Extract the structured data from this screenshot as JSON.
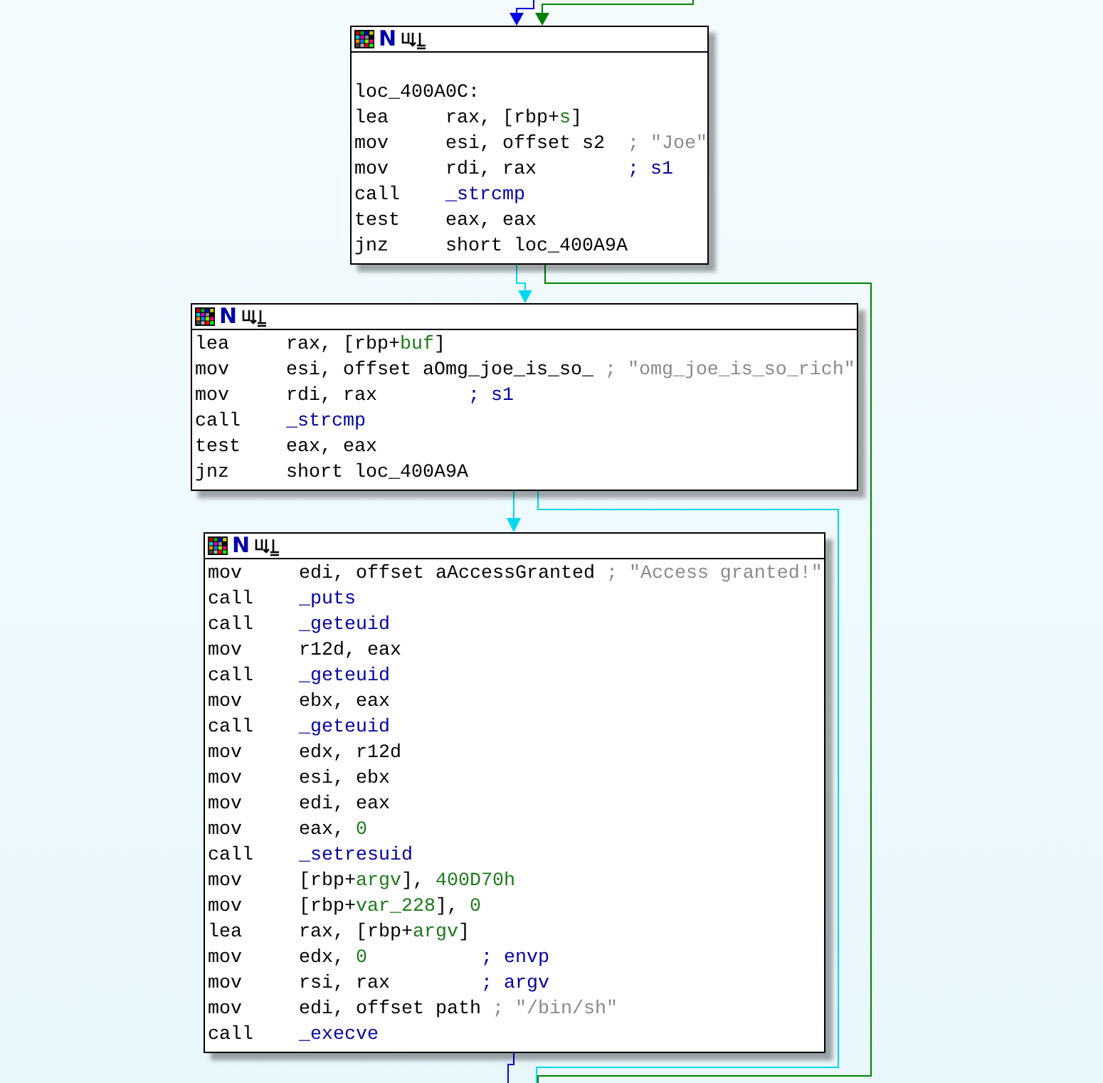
{
  "blocks": [
    {
      "header_glyph": "N",
      "label": "loc_400A0C:",
      "lines": [
        {
          "mnemonic": "lea",
          "operand": [
            {
              "text": "rax, [rbp+",
              "kind": "plain"
            },
            {
              "text": "s",
              "kind": "var"
            },
            {
              "text": "]",
              "kind": "plain"
            }
          ]
        },
        {
          "mnemonic": "mov",
          "operand": [
            {
              "text": "esi, offset s2",
              "kind": "plain"
            }
          ],
          "comment": [
            {
              "text": "; \"Joe\"",
              "kind": "string"
            }
          ]
        },
        {
          "mnemonic": "mov",
          "operand": [
            {
              "text": "rdi, rax",
              "kind": "plain"
            }
          ],
          "comment": [
            {
              "text": "; s1",
              "kind": "comment"
            }
          ]
        },
        {
          "mnemonic": "call",
          "operand": [
            {
              "text": "_strcmp",
              "kind": "func"
            }
          ]
        },
        {
          "mnemonic": "test",
          "operand": [
            {
              "text": "eax, eax",
              "kind": "plain"
            }
          ]
        },
        {
          "mnemonic": "jnz",
          "operand": [
            {
              "text": "short loc_400A9A",
              "kind": "plain"
            }
          ]
        }
      ]
    },
    {
      "header_glyph": "N",
      "lines": [
        {
          "mnemonic": "lea",
          "operand": [
            {
              "text": "rax, [rbp+",
              "kind": "plain"
            },
            {
              "text": "buf",
              "kind": "var"
            },
            {
              "text": "]",
              "kind": "plain"
            }
          ]
        },
        {
          "mnemonic": "mov",
          "operand": [
            {
              "text": "esi, offset aOmg_joe_is_so_",
              "kind": "plain"
            }
          ],
          "comment": [
            {
              "text": "; \"omg_joe_is_so_rich\"",
              "kind": "string"
            }
          ]
        },
        {
          "mnemonic": "mov",
          "operand": [
            {
              "text": "rdi, rax",
              "kind": "plain"
            }
          ],
          "comment": [
            {
              "text": "; s1",
              "kind": "comment"
            }
          ]
        },
        {
          "mnemonic": "call",
          "operand": [
            {
              "text": "_strcmp",
              "kind": "func"
            }
          ]
        },
        {
          "mnemonic": "test",
          "operand": [
            {
              "text": "eax, eax",
              "kind": "plain"
            }
          ]
        },
        {
          "mnemonic": "jnz",
          "operand": [
            {
              "text": "short loc_400A9A",
              "kind": "plain"
            }
          ]
        }
      ]
    },
    {
      "header_glyph": "N",
      "lines": [
        {
          "mnemonic": "mov",
          "operand": [
            {
              "text": "edi, offset aAccessGranted",
              "kind": "plain"
            }
          ],
          "comment": [
            {
              "text": "; \"Access granted!\"",
              "kind": "string"
            }
          ]
        },
        {
          "mnemonic": "call",
          "operand": [
            {
              "text": "_puts",
              "kind": "func"
            }
          ]
        },
        {
          "mnemonic": "call",
          "operand": [
            {
              "text": "_geteuid",
              "kind": "func"
            }
          ]
        },
        {
          "mnemonic": "mov",
          "operand": [
            {
              "text": "r12d, eax",
              "kind": "plain"
            }
          ]
        },
        {
          "mnemonic": "call",
          "operand": [
            {
              "text": "_geteuid",
              "kind": "func"
            }
          ]
        },
        {
          "mnemonic": "mov",
          "operand": [
            {
              "text": "ebx, eax",
              "kind": "plain"
            }
          ]
        },
        {
          "mnemonic": "call",
          "operand": [
            {
              "text": "_geteuid",
              "kind": "func"
            }
          ]
        },
        {
          "mnemonic": "mov",
          "operand": [
            {
              "text": "edx, r12d",
              "kind": "plain"
            }
          ]
        },
        {
          "mnemonic": "mov",
          "operand": [
            {
              "text": "esi, ebx",
              "kind": "plain"
            }
          ]
        },
        {
          "mnemonic": "mov",
          "operand": [
            {
              "text": "edi, eax",
              "kind": "plain"
            }
          ]
        },
        {
          "mnemonic": "mov",
          "operand": [
            {
              "text": "eax, ",
              "kind": "plain"
            },
            {
              "text": "0",
              "kind": "num"
            }
          ]
        },
        {
          "mnemonic": "call",
          "operand": [
            {
              "text": "_setresuid",
              "kind": "func"
            }
          ]
        },
        {
          "mnemonic": "mov",
          "operand": [
            {
              "text": "[rbp+",
              "kind": "plain"
            },
            {
              "text": "argv",
              "kind": "var"
            },
            {
              "text": "], ",
              "kind": "plain"
            },
            {
              "text": "400D70h",
              "kind": "num"
            }
          ]
        },
        {
          "mnemonic": "mov",
          "operand": [
            {
              "text": "[rbp+",
              "kind": "plain"
            },
            {
              "text": "var_228",
              "kind": "var"
            },
            {
              "text": "], ",
              "kind": "plain"
            },
            {
              "text": "0",
              "kind": "num"
            }
          ]
        },
        {
          "mnemonic": "lea",
          "operand": [
            {
              "text": "rax, [rbp+",
              "kind": "plain"
            },
            {
              "text": "argv",
              "kind": "var"
            },
            {
              "text": "]",
              "kind": "plain"
            }
          ]
        },
        {
          "mnemonic": "mov",
          "operand": [
            {
              "text": "edx, ",
              "kind": "plain"
            },
            {
              "text": "0",
              "kind": "num"
            }
          ],
          "comment": [
            {
              "text": "; envp",
              "kind": "comment"
            }
          ]
        },
        {
          "mnemonic": "mov",
          "operand": [
            {
              "text": "rsi, rax",
              "kind": "plain"
            }
          ],
          "comment": [
            {
              "text": "; argv",
              "kind": "comment"
            }
          ]
        },
        {
          "mnemonic": "mov",
          "operand": [
            {
              "text": "edi, offset path",
              "kind": "plain"
            }
          ],
          "comment": [
            {
              "text": "; \"/bin/sh\"",
              "kind": "string"
            }
          ]
        },
        {
          "mnemonic": "call",
          "operand": [
            {
              "text": "_execve",
              "kind": "func"
            }
          ]
        }
      ]
    }
  ]
}
